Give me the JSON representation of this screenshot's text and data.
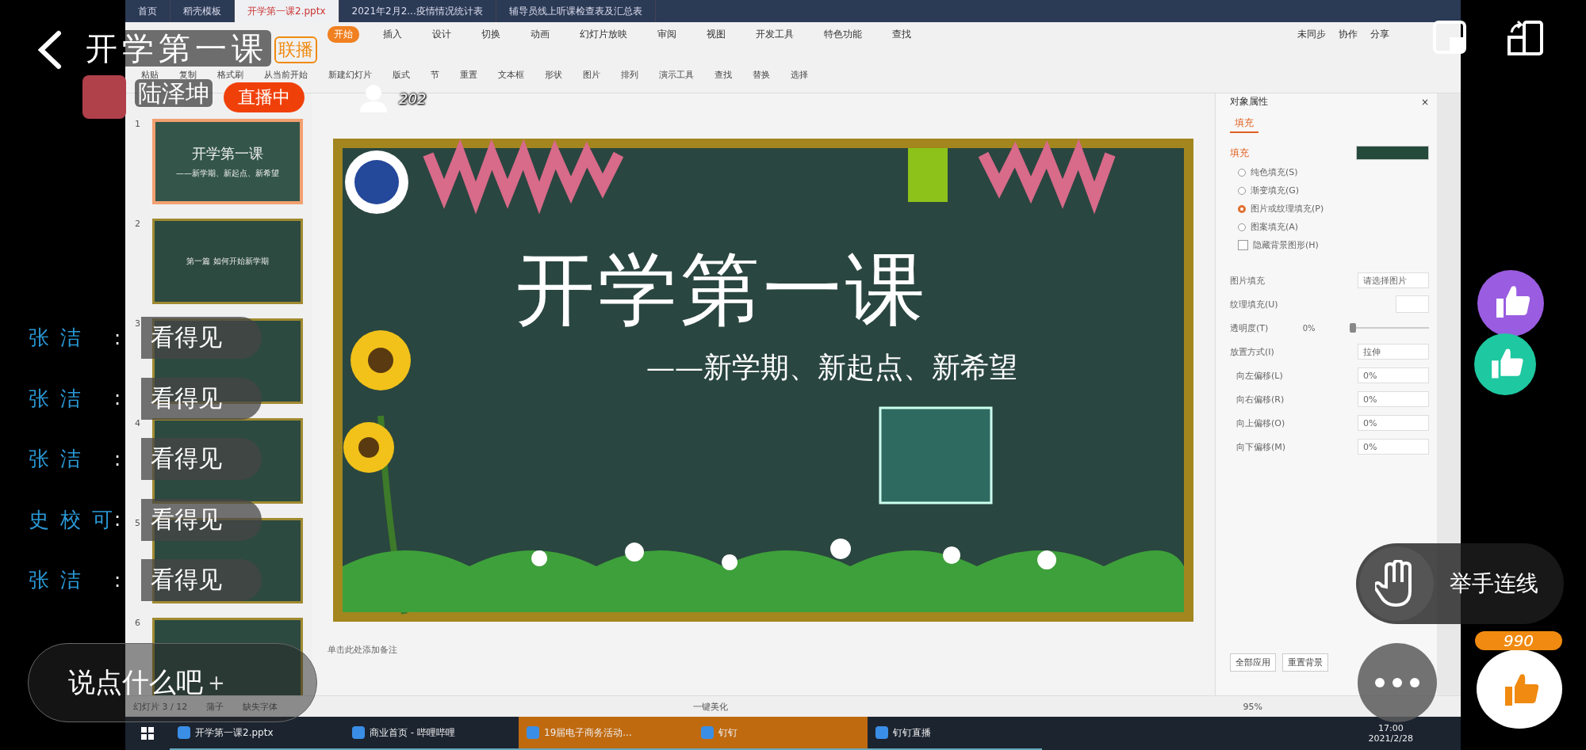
{
  "live": {
    "title": "开学第一课",
    "badge": "联播",
    "host": "陆泽坤",
    "status": "直播中",
    "viewers": "202",
    "likes": "990",
    "comment_placeholder": "说点什么吧",
    "comment_add": "+",
    "raise_hand": "举手连线"
  },
  "chat": [
    {
      "name": "张洁",
      "separator": ":",
      "text": "看得见"
    },
    {
      "name": "张洁",
      "separator": ":",
      "text": "看得见"
    },
    {
      "name": "张洁",
      "separator": ":",
      "text": "看得见"
    },
    {
      "name": "史校可",
      "separator": ":",
      "text": "看得见"
    },
    {
      "name": "张洁",
      "separator": ":",
      "text": "看得见"
    }
  ],
  "shared_screen": {
    "doc_tabs": [
      {
        "label": "首页",
        "selected": false
      },
      {
        "label": "稻壳模板",
        "selected": false
      },
      {
        "label": "开学第一课2.pptx",
        "selected": true
      },
      {
        "label": "2021年2月2...疫情情况统计表",
        "selected": false
      },
      {
        "label": "辅导员线上听课检查表及汇总表",
        "selected": false
      }
    ],
    "menu": [
      {
        "label": "开始",
        "selected": true
      },
      {
        "label": "插入",
        "selected": false
      },
      {
        "label": "设计",
        "selected": false
      },
      {
        "label": "切换",
        "selected": false
      },
      {
        "label": "动画",
        "selected": false
      },
      {
        "label": "幻灯片放映",
        "selected": false
      },
      {
        "label": "审阅",
        "selected": false
      },
      {
        "label": "视图",
        "selected": false
      },
      {
        "label": "开发工具",
        "selected": false
      },
      {
        "label": "特色功能",
        "selected": false
      },
      {
        "label": "查找",
        "selected": false
      }
    ],
    "menu_right": [
      "未同步",
      "协作",
      "分享"
    ],
    "ribbon": [
      "粘贴",
      "复制",
      "格式刷",
      "从当前开始",
      "新建幻灯片",
      "版式",
      "节",
      "重置",
      "文本框",
      "形状",
      "图片",
      "排列",
      "演示工具",
      "查找",
      "替换",
      "选择"
    ],
    "thumbnails": [
      {
        "number": "1",
        "title": "开学第一课",
        "subtitle": "——新学期、新起点、新希望",
        "selected": true
      },
      {
        "number": "2",
        "title": "第一篇  如何开始新学期",
        "selected": false
      },
      {
        "number": "3",
        "selected": false
      },
      {
        "number": "4",
        "selected": false
      },
      {
        "number": "5",
        "selected": false
      },
      {
        "number": "6",
        "selected": false
      }
    ],
    "slide": {
      "title": "开学第一课",
      "subtitle": "——新学期、新起点、新希望"
    },
    "notes_placeholder": "单击此处添加备注",
    "pane": {
      "title": "对象属性",
      "close": "×",
      "tab": "填充",
      "section": "填充",
      "fill_options": [
        {
          "label": "纯色填充(S)",
          "selected": false
        },
        {
          "label": "渐变填充(G)",
          "selected": false
        },
        {
          "label": "图片或纹理填充(P)",
          "selected": true
        },
        {
          "label": "图案填充(A)",
          "selected": false
        }
      ],
      "hide_background": {
        "label": "隐藏背景图形(H)",
        "checked": false
      },
      "picture_fill": {
        "label": "图片填充",
        "value": "请选择图片"
      },
      "texture_fill": {
        "label": "纹理填充(U)"
      },
      "transparency": {
        "label": "透明度(T)",
        "reading": "0%",
        "level": 0
      },
      "placement": {
        "label": "放置方式(I)",
        "value": "拉伸"
      },
      "offsets": [
        {
          "label": "向左偏移(L)",
          "value": "0%"
        },
        {
          "label": "向右偏移(R)",
          "value": "0%"
        },
        {
          "label": "向上偏移(O)",
          "value": "0%"
        },
        {
          "label": "向下偏移(M)",
          "value": "0%"
        }
      ],
      "buttons": [
        "全部应用",
        "重置背景"
      ]
    },
    "status_bar": {
      "slide_count": "幻灯片 3 / 12",
      "theme": "蒲子",
      "missing_fonts": "缺失字体",
      "beautify": "一键美化",
      "zoom": "95%"
    },
    "taskbar": [
      {
        "label": "开学第一课2.pptx",
        "highlighted": false
      },
      {
        "label": "商业首页 - 哔哩哔哩",
        "highlighted": false
      },
      {
        "label": "19届电子商务活动...",
        "highlighted": true
      },
      {
        "label": "钉钉",
        "highlighted": true
      },
      {
        "label": "钉钉直播",
        "highlighted": false
      }
    ],
    "clock": {
      "time": "17:00",
      "date": "2021/2/28"
    }
  }
}
